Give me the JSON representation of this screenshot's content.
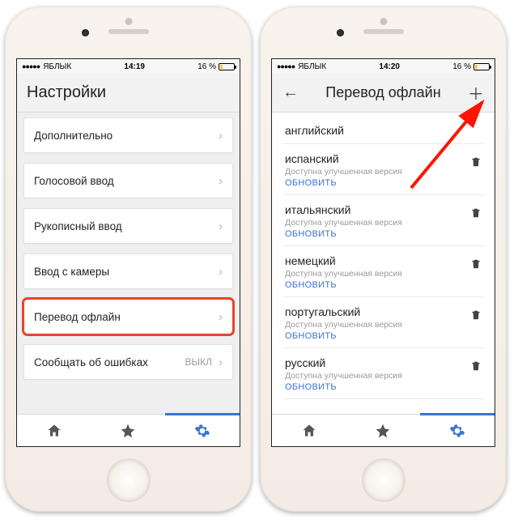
{
  "status": {
    "carrier": "ЯБЛЫК",
    "battery_pct": "16 %"
  },
  "screen1": {
    "time": "14:19",
    "title": "Настройки",
    "items": [
      {
        "label": "Дополнительно"
      },
      {
        "label": "Голосовой ввод"
      },
      {
        "label": "Рукописный ввод"
      },
      {
        "label": "Ввод с камеры"
      },
      {
        "label": "Перевод офлайн",
        "highlighted": true
      },
      {
        "label": "Сообщать об ошибках",
        "aux": "ВЫКЛ"
      }
    ]
  },
  "screen2": {
    "time": "14:20",
    "title": "Перевод офлайн",
    "sub_text": "Доступна улучшенная версия",
    "update_text": "ОБНОВИТЬ",
    "languages": [
      {
        "name": "английский",
        "deletable": false,
        "updatable": false
      },
      {
        "name": "испанский",
        "deletable": true,
        "updatable": true
      },
      {
        "name": "итальянский",
        "deletable": true,
        "updatable": true
      },
      {
        "name": "немецкий",
        "deletable": true,
        "updatable": true
      },
      {
        "name": "португальский",
        "deletable": true,
        "updatable": true
      },
      {
        "name": "русский",
        "deletable": true,
        "updatable": true
      }
    ]
  }
}
